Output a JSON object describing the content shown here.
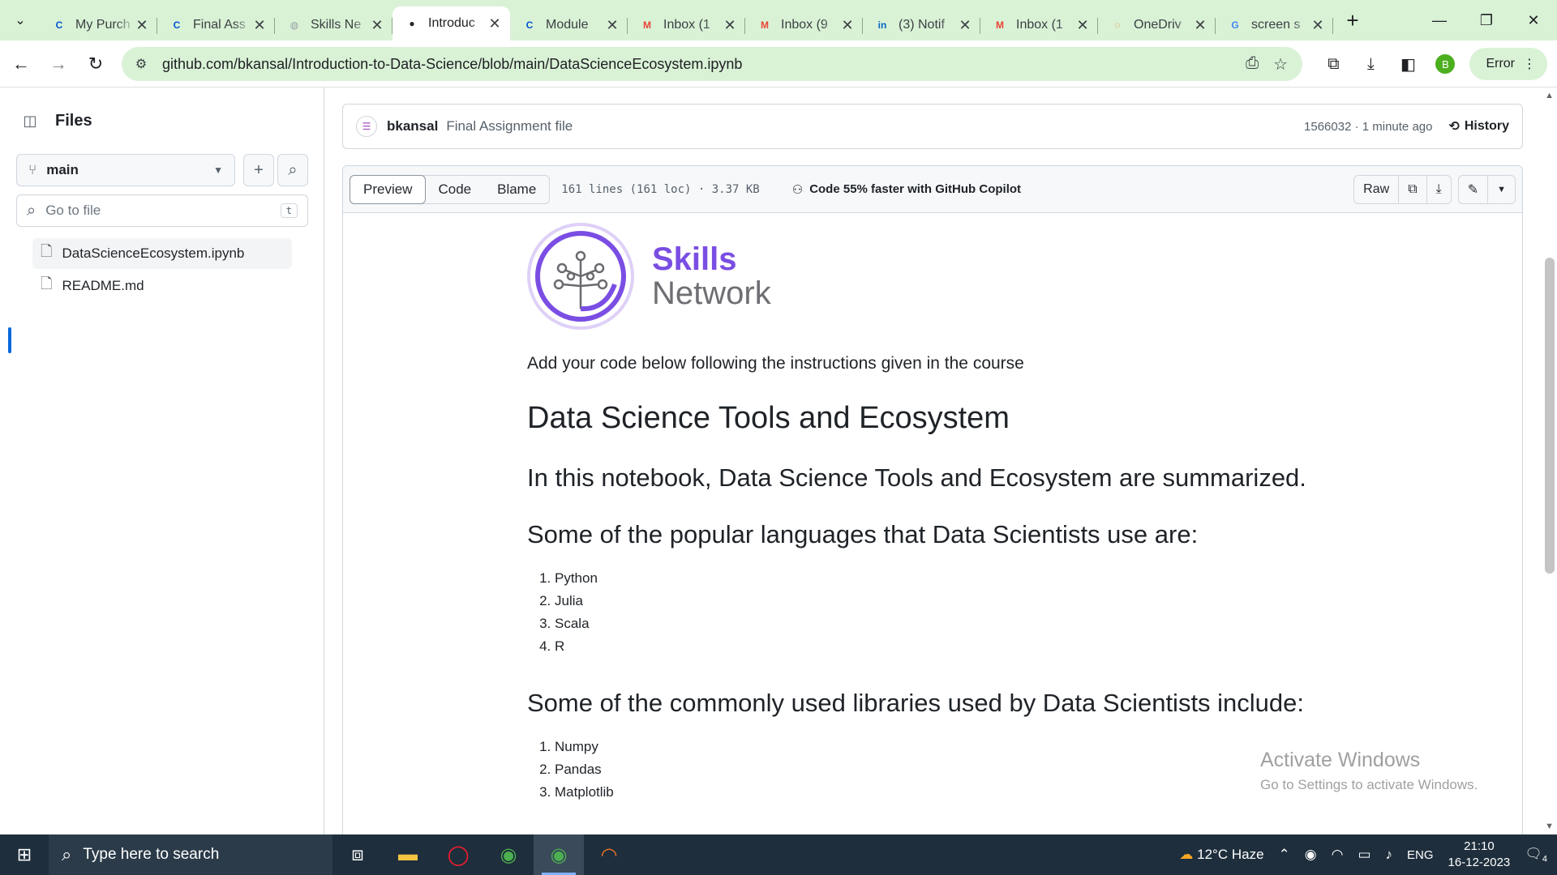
{
  "browser": {
    "tabs": [
      {
        "title": "My Purch",
        "icon": "coursera-icon",
        "color": "#0056d2",
        "glyph": "C"
      },
      {
        "title": "Final Ass",
        "icon": "coursera-icon",
        "color": "#0056d2",
        "glyph": "C"
      },
      {
        "title": "Skills Ne",
        "icon": "globe-icon",
        "color": "#9aa0a6",
        "glyph": "◍"
      },
      {
        "title": "Introduc",
        "icon": "github-icon",
        "color": "#24292f",
        "glyph": "●",
        "active": true
      },
      {
        "title": "Module",
        "icon": "coursera-icon",
        "color": "#0056d2",
        "glyph": "C"
      },
      {
        "title": "Inbox (1",
        "icon": "gmail-icon",
        "color": "#ea4335",
        "glyph": "M"
      },
      {
        "title": "Inbox (9",
        "icon": "gmail-icon",
        "color": "#ea4335",
        "glyph": "M"
      },
      {
        "title": "(3) Notif",
        "icon": "linkedin-icon",
        "color": "#0a66c2",
        "glyph": "in"
      },
      {
        "title": "Inbox (1",
        "icon": "gmail-icon",
        "color": "#ea4335",
        "glyph": "M"
      },
      {
        "title": "OneDriv",
        "icon": "onedrive-icon",
        "color": "#e67e22",
        "glyph": "◌"
      },
      {
        "title": "screen s",
        "icon": "google-icon",
        "color": "#4285f4",
        "glyph": "G"
      }
    ],
    "url": "github.com/bkansal/Introduction-to-Data-Science/blob/main/DataScienceEcosystem.ipynb",
    "profile_initial": "B",
    "error_label": "Error"
  },
  "sidebar": {
    "title": "Files",
    "branch": "main",
    "search_placeholder": "Go to file",
    "search_shortcut": "t",
    "files": [
      {
        "name": "DataScienceEcosystem.ipynb"
      },
      {
        "name": "README.md"
      }
    ]
  },
  "commit": {
    "author": "bkansal",
    "message": "Final Assignment file",
    "meta": "1566032 · 1 minute ago",
    "history_label": "History"
  },
  "file_header": {
    "tabs": [
      "Preview",
      "Code",
      "Blame"
    ],
    "stats": "161 lines (161 loc) · 3.37 KB",
    "copilot": "Code 55% faster with GitHub Copilot",
    "raw_label": "Raw"
  },
  "notebook": {
    "logo_line1": "Skills",
    "logo_line2": "Network",
    "intro": "Add your code below following the instructions given in the course",
    "h1": "Data Science Tools and Ecosystem",
    "h2a": "In this notebook, Data Science Tools and Ecosystem are summarized.",
    "h2b": "Some of the popular languages that Data Scientists use are:",
    "languages": [
      "Python",
      "Julia",
      "Scala",
      "R"
    ],
    "h2c": "Some of the commonly used libraries used by Data Scientists include:",
    "libraries": [
      "Numpy",
      "Pandas",
      "Matplotlib"
    ]
  },
  "watermark": {
    "line1": "Activate Windows",
    "line2": "Go to Settings to activate Windows."
  },
  "taskbar": {
    "search_placeholder": "Type here to search",
    "weather": "12°C  Haze",
    "language": "ENG",
    "time": "21:10",
    "date": "16-12-2023",
    "notification_count": "4"
  }
}
